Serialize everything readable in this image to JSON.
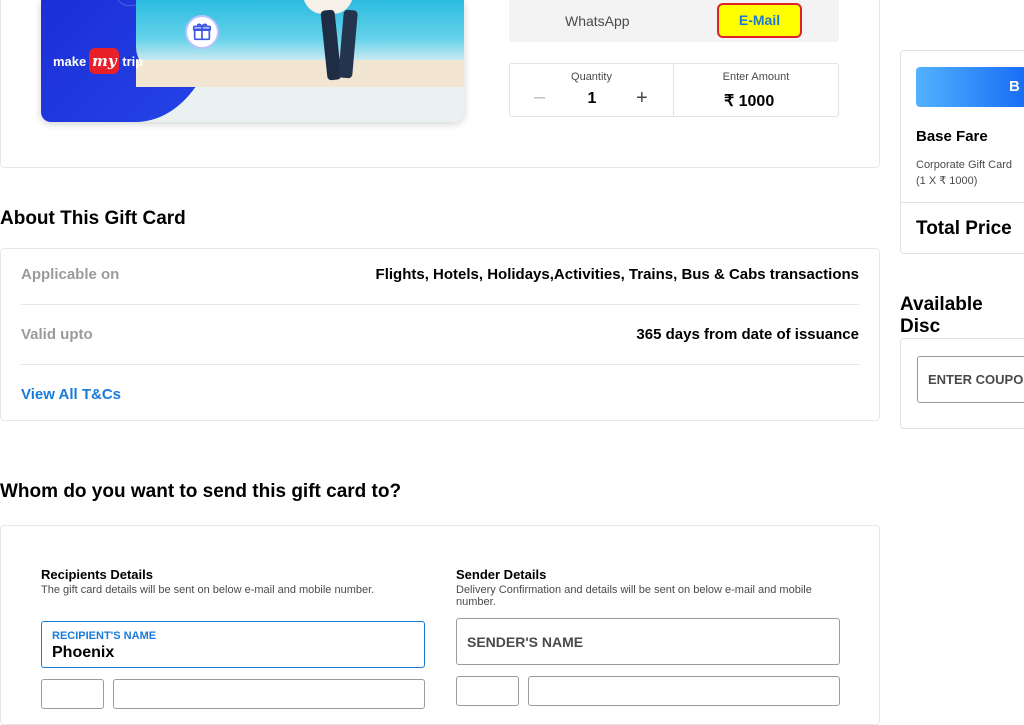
{
  "product": {
    "brand_left": "make",
    "brand_mark": "my",
    "brand_right": "trip",
    "delivery": {
      "whatsapp_label": "WhatsApp",
      "email_label": "E-Mail"
    },
    "quantity": {
      "label": "Quantity",
      "minus": "–",
      "value": "1",
      "plus": "+"
    },
    "amount": {
      "label": "Enter Amount",
      "value": "₹ 1000"
    }
  },
  "about": {
    "title": "About This Gift Card",
    "rows": [
      {
        "label": "Applicable on",
        "value": "Flights, Hotels, Holidays,Activities, Trains, Bus & Cabs transactions"
      },
      {
        "label": "Valid upto",
        "value": "365 days from date of issuance"
      }
    ],
    "tnc_link": "View All T&Cs"
  },
  "whom": {
    "title": "Whom do you want to send this gift card to?",
    "recipient": {
      "title": "Recipients Details",
      "subtitle": "The gift card details will be sent on below e-mail and mobile number.",
      "name_label": "RECIPIENT'S NAME",
      "name_value": "Phoenix"
    },
    "sender": {
      "title": "Sender Details",
      "subtitle": "Delivery Confirmation and details will be sent on below e-mail and mobile number.",
      "name_placeholder": "SENDER'S NAME"
    }
  },
  "fare": {
    "buy_label": "B",
    "base_fare": "Base Fare",
    "item_line1": "Corporate Gift Card",
    "item_line2": "(1 X ₹ 1000)",
    "total_price": "Total Price"
  },
  "discounts": {
    "title": "Available Disc",
    "coupon_placeholder": "ENTER COUPO"
  },
  "colors": {
    "accent_blue": "#1a7ad8",
    "email_highlight": "#ffff00",
    "email_border": "#e22222"
  }
}
